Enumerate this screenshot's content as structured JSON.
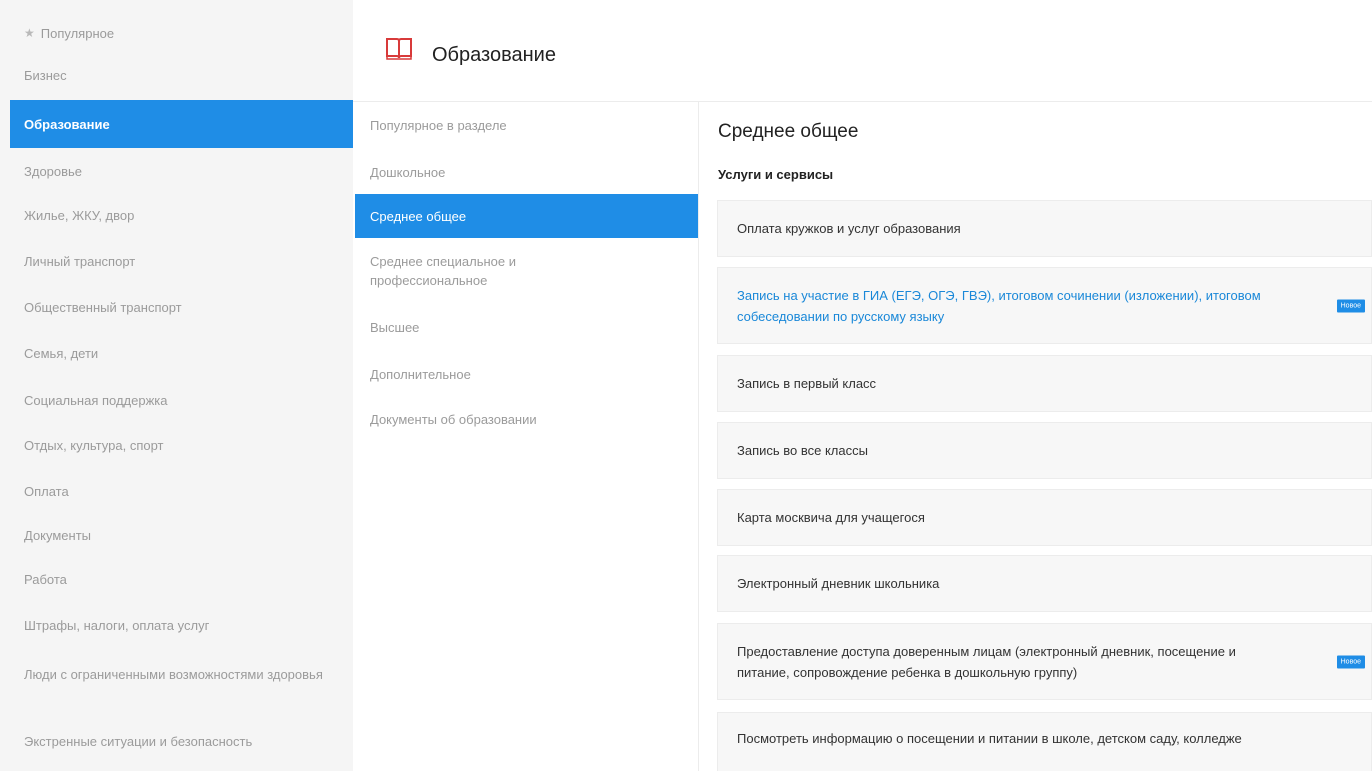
{
  "sidebar": {
    "items": [
      {
        "label": "Популярное"
      },
      {
        "label": "Бизнес"
      },
      {
        "label": "Образование"
      },
      {
        "label": "Здоровье"
      },
      {
        "label": "Жилье, ЖКУ, двор"
      },
      {
        "label": "Личный транспорт"
      },
      {
        "label": "Общественный транспорт"
      },
      {
        "label": "Семья, дети"
      },
      {
        "label": "Социальная поддержка"
      },
      {
        "label": "Отдых, культура, спорт"
      },
      {
        "label": "Оплата"
      },
      {
        "label": "Документы"
      },
      {
        "label": "Работа"
      },
      {
        "label": "Штрафы, налоги, оплата услуг"
      },
      {
        "label": "Люди с ограниченными возможностями здоровья"
      },
      {
        "label": "Экстренные ситуации и безопасность"
      }
    ]
  },
  "section": {
    "title": "Образование",
    "icon": "book-icon",
    "accent": "#d83a3a"
  },
  "subnav": {
    "items": [
      {
        "label": "Популярное в разделе"
      },
      {
        "label": "Дошкольное"
      },
      {
        "label": "Среднее общее"
      },
      {
        "label": "Среднее специальное и профессиональное"
      },
      {
        "label": "Высшее"
      },
      {
        "label": "Дополнительное"
      },
      {
        "label": "Документы об образовании"
      }
    ]
  },
  "content": {
    "title": "Среднее общее",
    "subtitle": "Услуги и сервисы",
    "cards": [
      {
        "label": "Оплата кружков и услуг образования"
      },
      {
        "label": "Запись на участие в ГИА (ЕГЭ, ОГЭ, ГВЭ), итоговом сочинении (изложении), итоговом собеседовании по русскому языку",
        "badge": "Новое"
      },
      {
        "label": "Запись в первый класс"
      },
      {
        "label": "Запись во все классы"
      },
      {
        "label": "Карта москвича для учащегося"
      },
      {
        "label": "Электронный дневник школьника"
      },
      {
        "label": "Предоставление доступа доверенным лицам (электронный дневник, посещение и питание, сопровождение ребенка в дошкольную группу)",
        "badge": "Новое"
      },
      {
        "label": "Посмотреть информацию о посещении и питании в школе, детском саду, колледже"
      }
    ]
  },
  "colors": {
    "active": "#1f8de6",
    "link": "#1a88d8",
    "sidebar_bg": "#f5f5f5",
    "card_bg": "#f7f7f7"
  }
}
